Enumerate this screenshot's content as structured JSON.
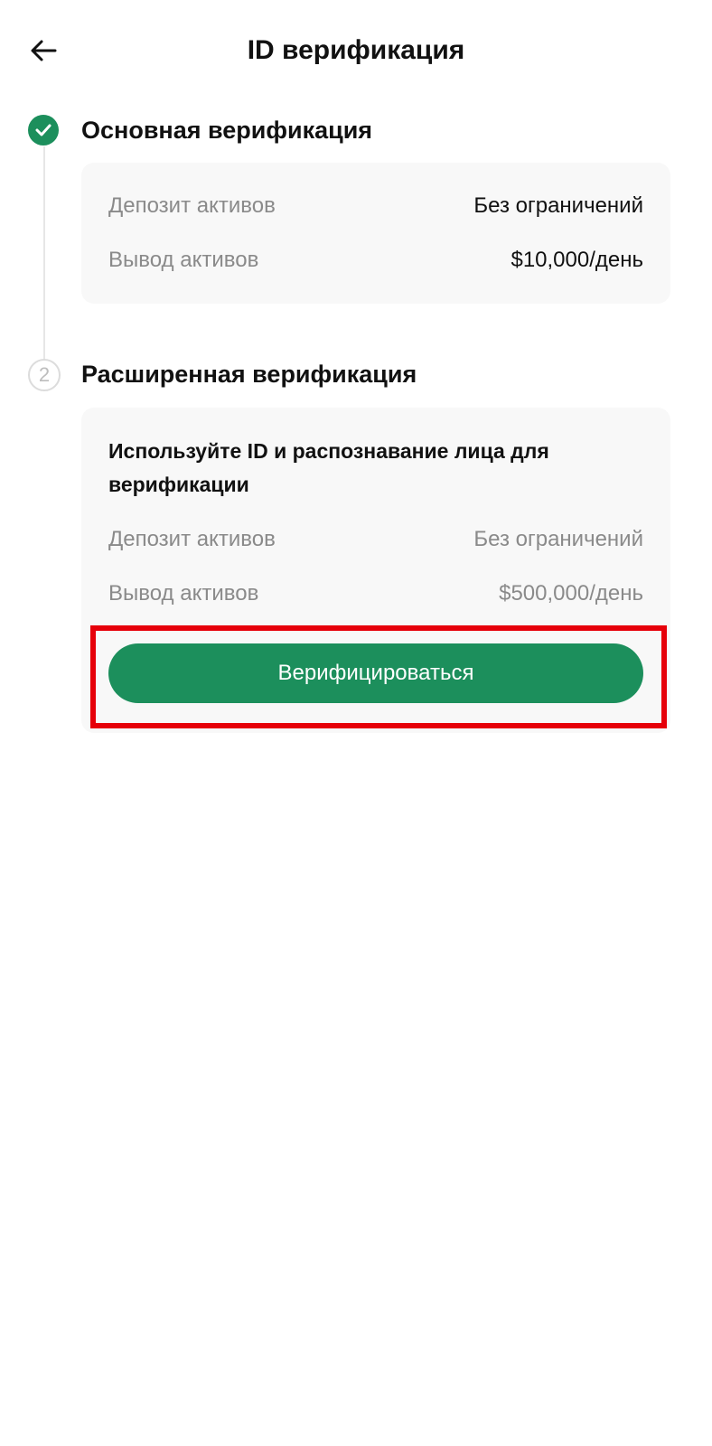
{
  "header": {
    "title": "ID верификация",
    "back_icon": "arrow-left-icon"
  },
  "steps": [
    {
      "title": "Основная верификация",
      "status": "completed",
      "icon": "check-icon",
      "rows": [
        {
          "label": "Депозит активов",
          "value": "Без ограничений"
        },
        {
          "label": "Вывод активов",
          "value": "$10,000/день"
        }
      ]
    },
    {
      "title": "Расширенная верификация",
      "number": "2",
      "description": "Используйте ID и распознавание лица для верификации",
      "rows": [
        {
          "label": "Депозит активов",
          "value": "Без ограничений"
        },
        {
          "label": "Вывод активов",
          "value": "$500,000/день"
        }
      ],
      "button_label": "Верифицироваться"
    }
  ],
  "colors": {
    "accent": "#1c8f5c",
    "highlight": "#e6000a",
    "card_bg": "#f8f8f8",
    "muted_text": "#8a8a8a"
  }
}
